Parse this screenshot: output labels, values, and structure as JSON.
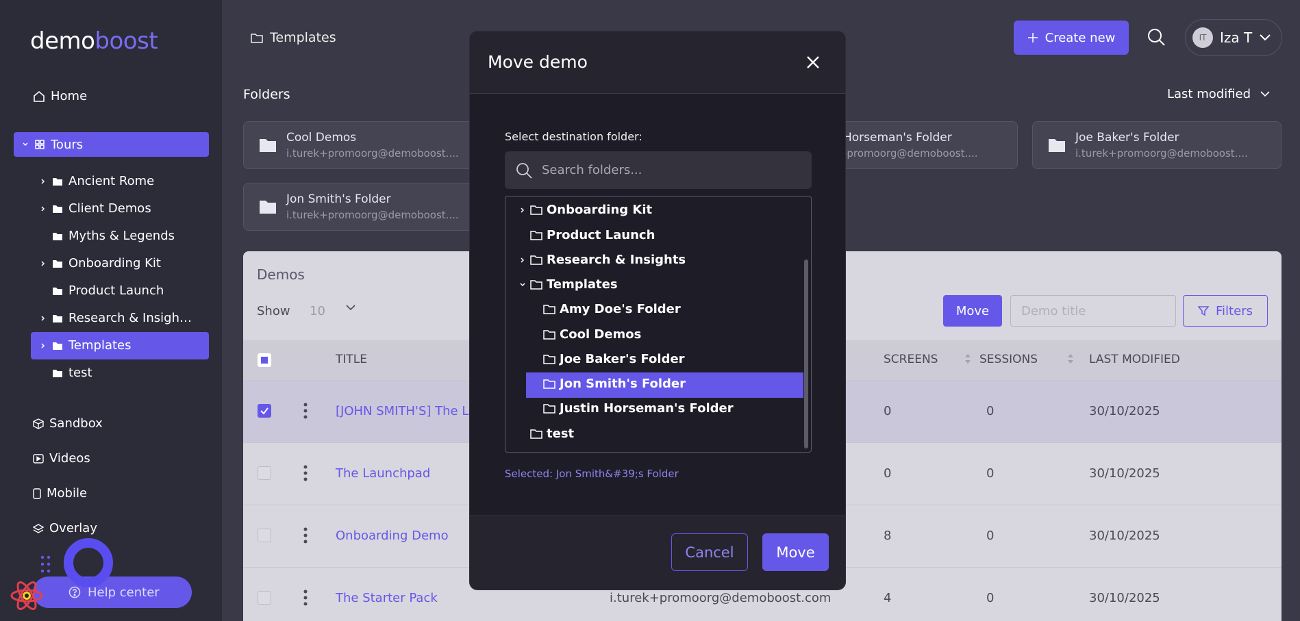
{
  "brand": {
    "part1": "demo",
    "part2": "boost"
  },
  "sidebar": {
    "home": "Home",
    "tours": "Tours",
    "tree": [
      "Ancient Rome",
      "Client Demos",
      "Myths & Legends",
      "Onboarding Kit",
      "Product Launch",
      "Research & Insigh…",
      "Templates",
      "test"
    ],
    "sandbox": "Sandbox",
    "videos": "Videos",
    "mobile": "Mobile",
    "overlay": "Overlay",
    "help": "Help center"
  },
  "header": {
    "breadcrumb": "Templates",
    "create": "Create new",
    "user_initials": "IT",
    "user_name": "Iza T"
  },
  "folders": {
    "heading": "Folders",
    "sort": "Last modified",
    "cards": [
      {
        "name": "Cool Demos",
        "email": "i.turek+promoorg@demoboost...."
      },
      {
        "name": "Horseman's Folder",
        "email": "-promoorg@demoboost...."
      },
      {
        "name": "Joe Baker's Folder",
        "email": "i.turek+promoorg@demoboost...."
      },
      {
        "name": "Jon Smith's Folder",
        "email": "i.turek+promoorg@demoboost...."
      }
    ]
  },
  "demos": {
    "heading": "Demos",
    "show_label": "Show",
    "show_value": "10",
    "move": "Move",
    "title_placeholder": "Demo title",
    "filters": "Filters",
    "columns": {
      "title": "TITLE",
      "screens": "SCREENS",
      "sessions": "SESSIONS",
      "modified": "LAST MODIFIED"
    },
    "rows": [
      {
        "title": "[JOHN SMITH'S] The La",
        "owner": "",
        "screens": "0",
        "sessions": "0",
        "modified": "30/10/2025"
      },
      {
        "title": "The Launchpad",
        "owner": "",
        "screens": "0",
        "sessions": "0",
        "modified": "30/10/2025"
      },
      {
        "title": "Onboarding Demo",
        "owner": "",
        "screens": "8",
        "sessions": "0",
        "modified": "30/10/2025"
      },
      {
        "title": "The Starter Pack",
        "owner": "i.turek+promoorg@demoboost.com",
        "screens": "4",
        "sessions": "0",
        "modified": "30/10/2025"
      }
    ]
  },
  "modal": {
    "title": "Move demo",
    "label": "Select destination folder:",
    "search_placeholder": "Search folders...",
    "tree": [
      "Onboarding Kit",
      "Product Launch",
      "Research & Insights",
      "Templates",
      "Amy Doe's Folder",
      "Cool Demos",
      "Joe Baker's Folder",
      "Jon Smith's Folder",
      "Justin Horseman's Folder",
      "test"
    ],
    "selected": "Selected: Jon Smith&#39;s Folder",
    "cancel": "Cancel",
    "move": "Move"
  },
  "colors": {
    "accent": "#6558e8",
    "sidebar": "#2c2b38",
    "modal": "#1e1d27"
  }
}
